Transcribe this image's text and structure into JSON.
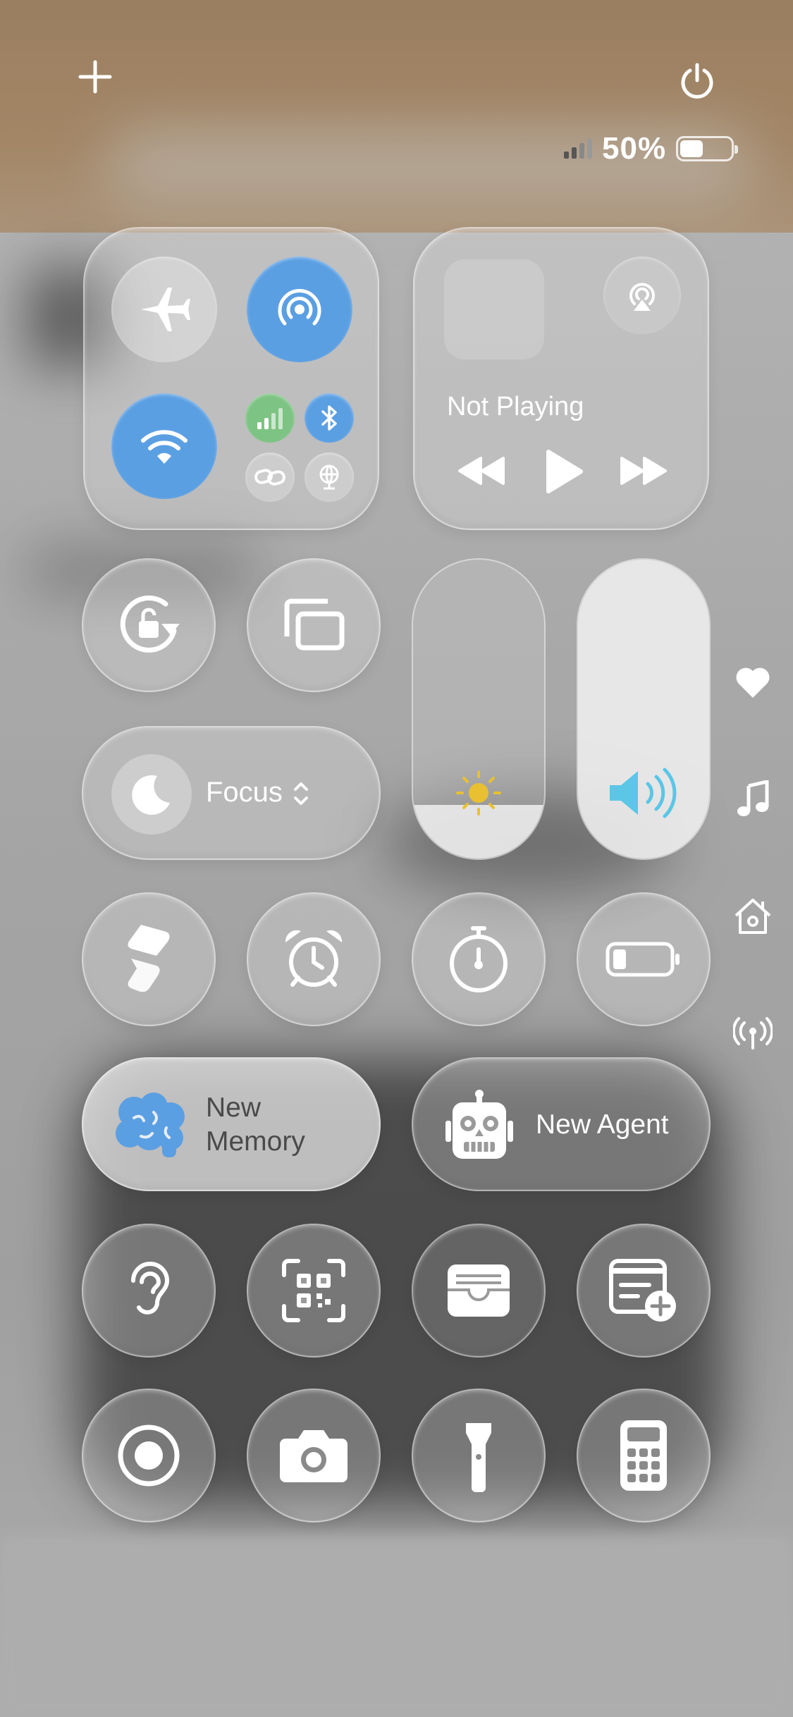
{
  "status": {
    "battery_percent": "50%",
    "battery_level": 0.5
  },
  "media": {
    "now_playing": "Not Playing"
  },
  "focus": {
    "label": "Focus"
  },
  "sliders": {
    "brightness_level": 0.18,
    "volume_level": 1.0
  },
  "shortcuts": {
    "new_memory_line1": "New",
    "new_memory_line2": "Memory",
    "new_agent": "New Agent"
  },
  "colors": {
    "accent_blue": "#5b9fe3",
    "cellular_green": "#7dc383",
    "brightness_sun": "#e8c032",
    "volume_cyan": "#5bc6e6"
  },
  "icons": [
    "plus-icon",
    "power-icon",
    "airplane-mode-icon",
    "airdrop-icon",
    "wifi-icon",
    "cellular-icon",
    "bluetooth-icon",
    "personal-hotspot-icon",
    "vpn-icon",
    "airplay-icon",
    "rewind-icon",
    "play-icon",
    "fast-forward-icon",
    "orientation-lock-icon",
    "screen-mirroring-icon",
    "moon-icon",
    "sun-icon",
    "speaker-icon",
    "shortcuts-icon",
    "alarm-icon",
    "timer-icon",
    "low-power-icon",
    "brain-icon",
    "robot-icon",
    "hearing-icon",
    "qr-code-icon",
    "wallet-icon",
    "quick-note-icon",
    "screen-record-icon",
    "camera-icon",
    "flashlight-icon",
    "calculator-icon",
    "heart-icon",
    "music-note-icon",
    "home-icon",
    "antenna-icon"
  ]
}
